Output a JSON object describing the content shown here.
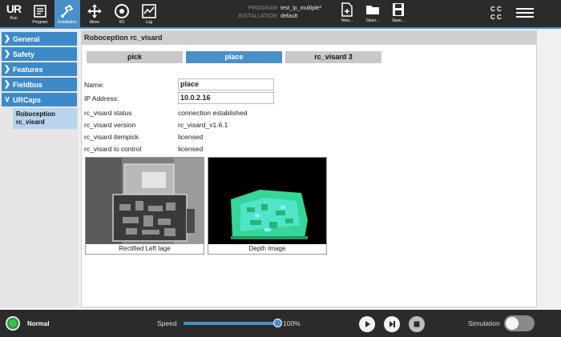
{
  "topbar": {
    "logo_label": "Run",
    "nav": [
      {
        "label": "Program",
        "icon": "program-icon"
      },
      {
        "label": "Installation",
        "icon": "installation-icon",
        "active": true
      },
      {
        "label": "Move",
        "icon": "move-icon"
      },
      {
        "label": "I/O",
        "icon": "io-icon"
      },
      {
        "label": "Log",
        "icon": "log-icon"
      }
    ],
    "program_key": "PROGRAM",
    "program_value": "test_ip_multiple*",
    "installation_key": "INSTALLATION",
    "installation_value": "default",
    "file_buttons": [
      {
        "label": "New...",
        "icon": "new-file-icon"
      },
      {
        "label": "Open...",
        "icon": "open-folder-icon"
      },
      {
        "label": "Save...",
        "icon": "save-icon"
      }
    ],
    "cc_line1": "C C",
    "cc_line2": "C C"
  },
  "sidebar": {
    "items": [
      {
        "label": "General"
      },
      {
        "label": "Safety"
      },
      {
        "label": "Features"
      },
      {
        "label": "Fieldbus"
      },
      {
        "label": "URCaps",
        "expanded": true
      }
    ],
    "sub_item_line1": "Roboception",
    "sub_item_line2": "rc_visard"
  },
  "main": {
    "title": "Roboception rc_visard",
    "tabs": [
      {
        "label": "pick"
      },
      {
        "label": "place",
        "active": true
      },
      {
        "label": "rc_visard 3"
      }
    ],
    "name_label": "Name:",
    "name_value": "place",
    "ip_label": "IP Address:",
    "ip_value": "10.0.2.16",
    "info": [
      {
        "label": "rc_visard status",
        "value": "connection established"
      },
      {
        "label": "rc_visard version",
        "value": "rc_visard_v1.6.1"
      },
      {
        "label": "rc_visard itempick",
        "value": "licensed"
      },
      {
        "label": "rc_visard io control",
        "value": "licensed"
      }
    ],
    "left_image_caption": "Rectified Left Iage",
    "depth_image_caption": "Depth Image"
  },
  "bottombar": {
    "status": "Normal",
    "speed_label": "Speed",
    "speed_value": "100%",
    "speed_fraction": 1.0,
    "simulation_label": "Simulation",
    "simulation_on": false
  },
  "colors": {
    "accent": "#4a90c8",
    "bar_bg": "#2b2b2b",
    "status_ok": "#39c24a"
  }
}
